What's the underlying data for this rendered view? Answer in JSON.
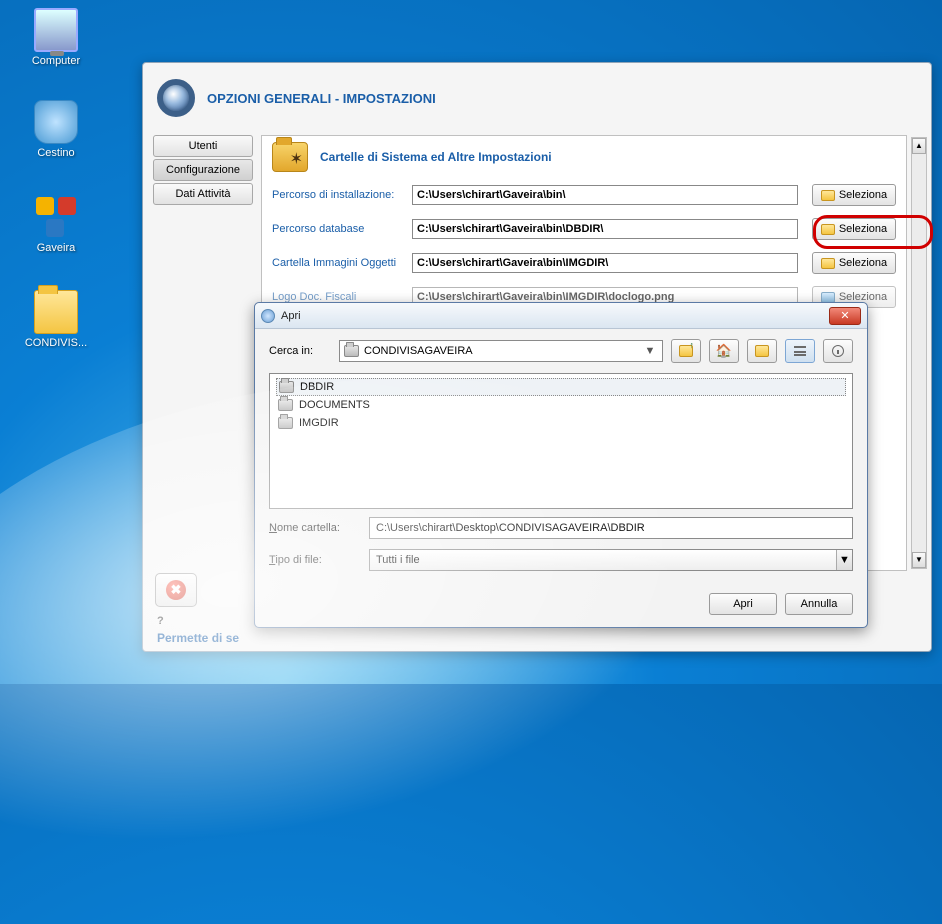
{
  "desktop": {
    "computer": "Computer",
    "cestino": "Cestino",
    "gaveira": "Gaveira",
    "condivis": "CONDIVIS..."
  },
  "main_window": {
    "title": "OPZIONI GENERALI - IMPOSTAZIONI",
    "tabs": {
      "utenti": "Utenti",
      "configurazione": "Configurazione",
      "dati": "Dati Attività"
    },
    "panel_title": "Cartelle di Sistema ed Altre Impostazioni",
    "rows": {
      "install": {
        "label": "Percorso di installazione:",
        "value": "C:\\Users\\chirart\\Gaveira\\bin\\",
        "button": "Seleziona"
      },
      "db": {
        "label": "Percorso database",
        "value": "C:\\Users\\chirart\\Gaveira\\bin\\DBDIR\\",
        "button": "Seleziona"
      },
      "img": {
        "label": "Cartella Immagini Oggetti",
        "value": "C:\\Users\\chirart\\Gaveira\\bin\\IMGDIR\\",
        "button": "Seleziona"
      },
      "logo": {
        "label": "Logo Doc. Fiscali",
        "value": "C:\\Users\\chirart\\Gaveira\\bin\\IMGDIR\\doclogo.png",
        "button": "Seleziona"
      }
    },
    "help": "?",
    "status": "Permette di se"
  },
  "dialog": {
    "title": "Apri",
    "search_in_label": "Cerca in:",
    "search_in_value": "CONDIVISAGAVEIRA",
    "items": {
      "dbdir": "DBDIR",
      "documents": "DOCUMENTS",
      "imgdir": "IMGDIR"
    },
    "folder_name_label": "Nome cartella:",
    "folder_name_value": "C:\\Users\\chirart\\Desktop\\CONDIVISAGAVEIRA\\DBDIR",
    "filetype_label": "Tipo di file:",
    "filetype_value": "Tutti i file",
    "open": "Apri",
    "cancel": "Annulla"
  }
}
